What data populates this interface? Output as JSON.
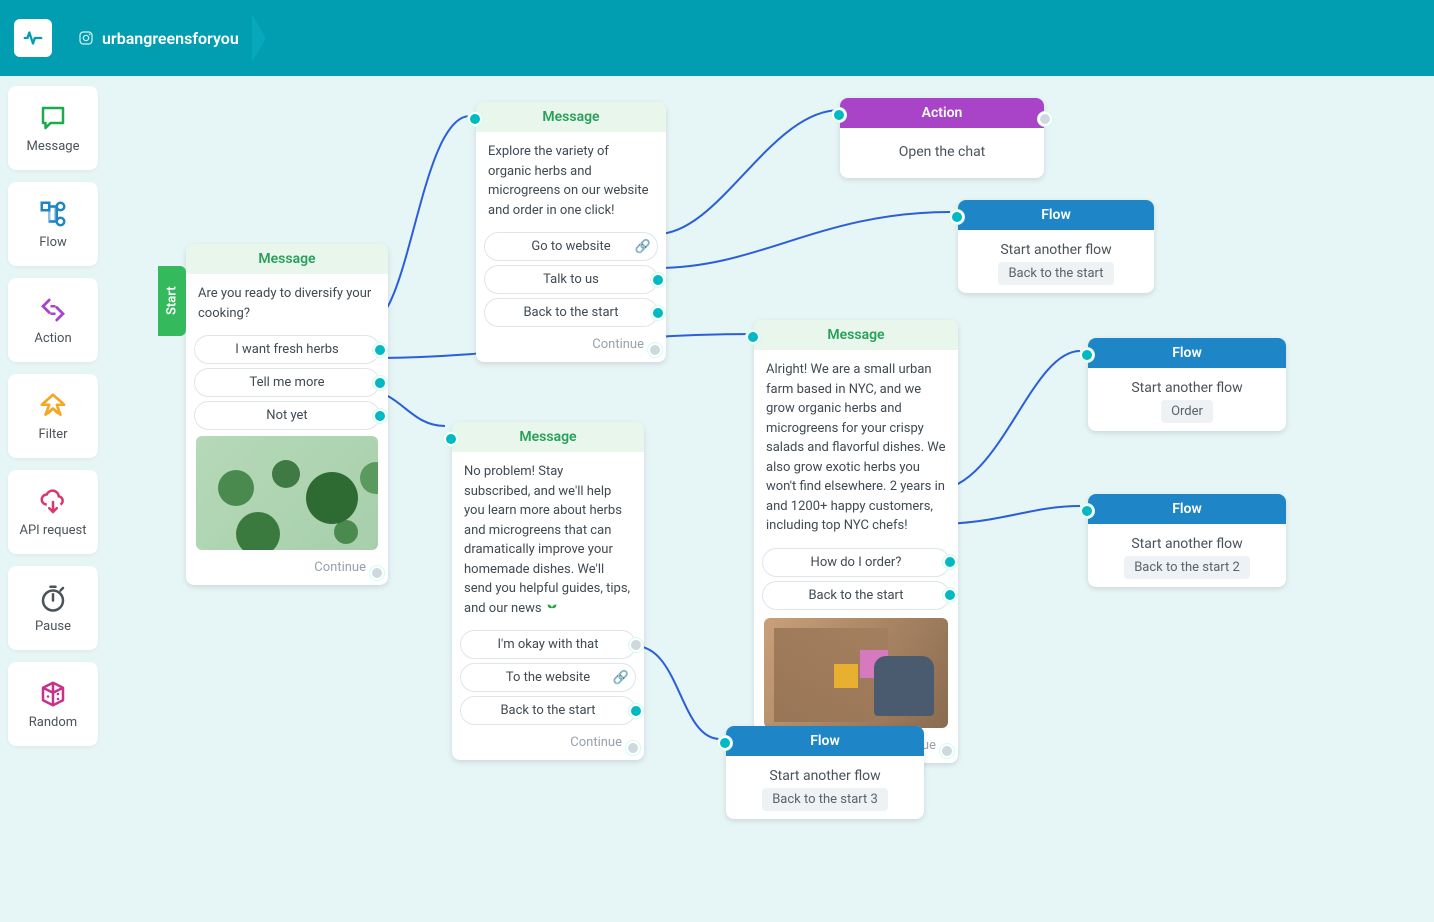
{
  "header": {
    "account": "urbangreensforyou"
  },
  "sidebar": {
    "items": [
      {
        "label": "Message"
      },
      {
        "label": "Flow"
      },
      {
        "label": "Action"
      },
      {
        "label": "Filter"
      },
      {
        "label": "API request"
      },
      {
        "label": "Pause"
      },
      {
        "label": "Random"
      }
    ]
  },
  "labels": {
    "message": "Message",
    "action": "Action",
    "flow": "Flow",
    "continue": "Continue",
    "start": "Start",
    "start_another": "Start another flow"
  },
  "nodes": {
    "start": {
      "text": "Are you ready to diversify your cooking?",
      "buttons": [
        "I want fresh herbs",
        "Tell me more",
        "Not yet"
      ]
    },
    "explore": {
      "text": "Explore the variety of organic herbs and microgreens on our website and order in one click!",
      "buttons": [
        "Go to website",
        "Talk to us",
        "Back to the start"
      ]
    },
    "noproblem": {
      "text": "No problem! Stay subscribed, and we'll help you learn more about herbs and microgreens that can dramatically improve your homemade dishes. We'll send you helpful guides, tips, and our news",
      "buttons": [
        "I'm okay with that",
        "To the website",
        "Back to the start"
      ]
    },
    "alright": {
      "text": "Alright! We are a small urban farm based in NYC, and we grow organic herbs and microgreens for your crispy salads and flavorful dishes. We also grow exotic herbs you won't find elsewhere. 2 years in and 1200+ happy customers, including top NYC chefs!",
      "buttons": [
        "How do I order?",
        "Back to the start"
      ]
    },
    "action_open": {
      "body": "Open the chat"
    },
    "flow1": {
      "pill": "Back to the start"
    },
    "flow2": {
      "pill": "Order"
    },
    "flow3": {
      "pill": "Back to the start 2"
    },
    "flow4": {
      "pill": "Back to the start 3"
    }
  }
}
